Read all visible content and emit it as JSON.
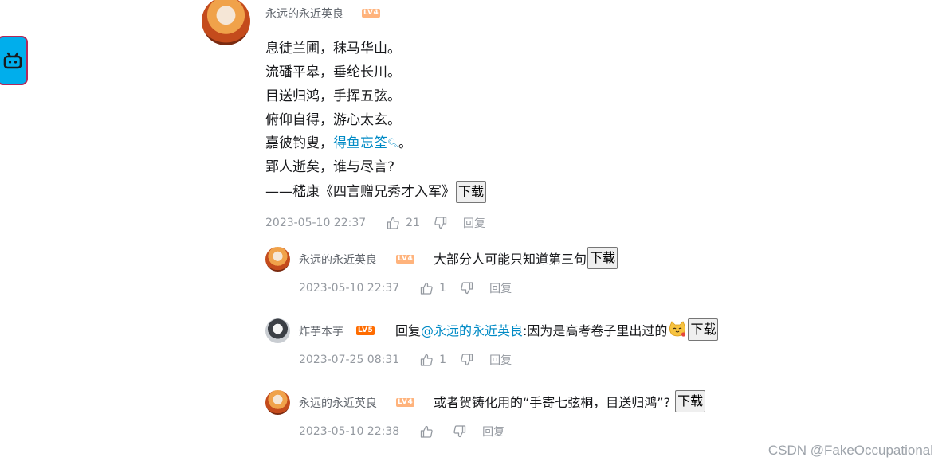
{
  "floating_button": {
    "icon": "bilibili-tv-icon"
  },
  "main_comment": {
    "username": "永远的永近英良",
    "level": "LV4",
    "lines": [
      "息徒兰圃，秣马华山。",
      "流磻平皋，垂纶长川。",
      "目送归鸿，手挥五弦。",
      "俯仰自得，游心太玄。"
    ],
    "line5_prefix": "嘉彼钓叟，",
    "line5_link": "得鱼忘筌",
    "line5_suffix": "。",
    "line6": "郢人逝矣，谁与尽言?",
    "line7": "——嵇康《四言赠兄秀才入军》",
    "download_label": "下载",
    "time": "2023-05-10 22:37",
    "likes": "21",
    "reply_label": "回复"
  },
  "replies": [
    {
      "username": "永远的永近英良",
      "level": "LV4",
      "text": "大部分人可能只知道第三句",
      "download_label": "下载",
      "time": "2023-05-10 22:37",
      "likes": "1",
      "reply_label": "回复"
    },
    {
      "username": "炸芋本芋",
      "level": "LV5",
      "reply_prefix": "回复 ",
      "mention": "@永远的永近英良",
      "text": " :因为是高考卷子里出过的",
      "download_label": "下载",
      "time": "2023-07-25 08:31",
      "likes": "1",
      "reply_label": "回复"
    },
    {
      "username": "永远的永近英良",
      "level": "LV4",
      "text": "或者贺铸化用的“手寄七弦桐，目送归鸿”?",
      "download_label": "下载",
      "time": "2023-05-10 22:38",
      "likes": "",
      "reply_label": "回复"
    }
  ],
  "watermark": "CSDN @FakeOccupational",
  "colors": {
    "link": "#008ac5",
    "lv4": "#ffb37c",
    "lv5": "#ff6c00",
    "bili_blue": "#00aeec"
  }
}
